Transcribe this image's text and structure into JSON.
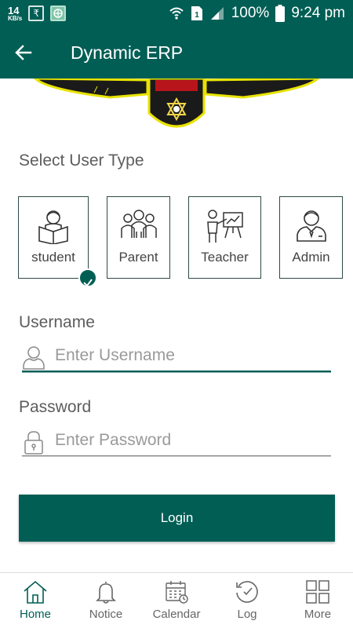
{
  "status_bar": {
    "net_speed_value": "14",
    "net_speed_unit": "KB/s",
    "battery_text": "100%",
    "time": "9:24 pm"
  },
  "app_bar": {
    "title": "Dynamic ERP"
  },
  "login": {
    "select_user_type_label": "Select User Type",
    "user_types": [
      {
        "label": "student",
        "selected": true
      },
      {
        "label": "Parent",
        "selected": false
      },
      {
        "label": "Teacher",
        "selected": false
      },
      {
        "label": "Admin",
        "selected": false
      }
    ],
    "username_label": "Username",
    "username_placeholder": "Enter Username",
    "password_label": "Password",
    "password_placeholder": "Enter Password",
    "login_button": "Login"
  },
  "bottom_nav": {
    "items": [
      {
        "label": "Home",
        "icon": "home-icon",
        "active": true
      },
      {
        "label": "Notice",
        "icon": "bell-icon",
        "active": false
      },
      {
        "label": "Calendar",
        "icon": "calendar-icon",
        "active": false
      },
      {
        "label": "Log",
        "icon": "clock-icon",
        "active": false
      },
      {
        "label": "More",
        "icon": "grid-icon",
        "active": false
      }
    ]
  },
  "colors": {
    "primary": "#005e55",
    "text_muted": "#5d5d5d"
  }
}
